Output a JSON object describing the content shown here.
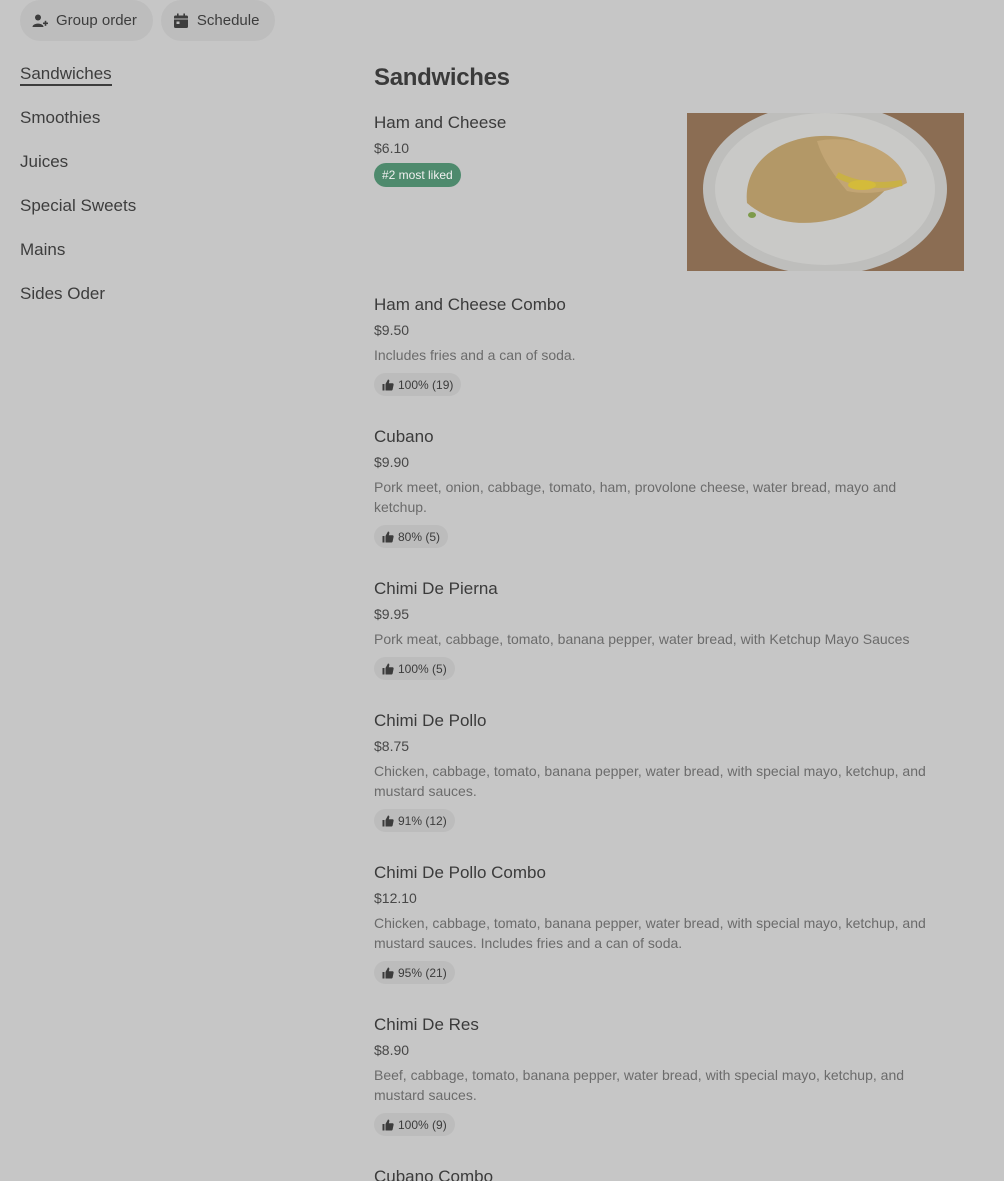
{
  "topbar": {
    "group_order_label": "Group order",
    "schedule_label": "Schedule"
  },
  "sidebar": {
    "items": [
      {
        "label": "Sandwiches",
        "active": true
      },
      {
        "label": "Smoothies"
      },
      {
        "label": "Juices"
      },
      {
        "label": "Special Sweets"
      },
      {
        "label": "Mains"
      },
      {
        "label": "Sides Oder"
      }
    ]
  },
  "section": {
    "title": "Sandwiches"
  },
  "items": [
    {
      "name": "Ham and Cheese",
      "price": "$6.10",
      "badge": "#2 most liked",
      "image": "ham-and-cheese-sandwich"
    },
    {
      "name": "Ham and Cheese Combo",
      "price": "$9.50",
      "description": "Includes fries and a can of soda.",
      "rating": "100% (19)"
    },
    {
      "name": "Cubano",
      "price": "$9.90",
      "description": "Pork meet, onion, cabbage, tomato, ham, provolone cheese, water bread, mayo and ketchup.",
      "rating": "80% (5)"
    },
    {
      "name": "Chimi De Pierna",
      "price": "$9.95",
      "description": "Pork meat, cabbage, tomato, banana pepper, water bread, with Ketchup Mayo Sauces",
      "rating": "100% (5)"
    },
    {
      "name": "Chimi De Pollo",
      "price": "$8.75",
      "description": "Chicken, cabbage, tomato, banana pepper, water bread, with special mayo, ketchup, and mustard sauces.",
      "rating": "91% (12)"
    },
    {
      "name": "Chimi De Pollo Combo",
      "price": "$12.10",
      "description": "Chicken, cabbage, tomato, banana pepper, water bread, with special mayo, ketchup, and mustard sauces. Includes fries and a can of soda.",
      "rating": "95% (21)"
    },
    {
      "name": "Chimi De Res",
      "price": "$8.90",
      "description": "Beef, cabbage, tomato, banana pepper, water bread, with special mayo, ketchup, and mustard sauces.",
      "rating": "100% (9)"
    },
    {
      "name": "Cubano Combo"
    }
  ],
  "icons": {
    "group_order": "person-add-icon",
    "schedule": "calendar-icon",
    "rating": "thumbs-up-icon"
  },
  "colors": {
    "background": "#c6c6c6",
    "badge_green": "#4e8a6d",
    "pill_bg": "#bdbdbd"
  }
}
